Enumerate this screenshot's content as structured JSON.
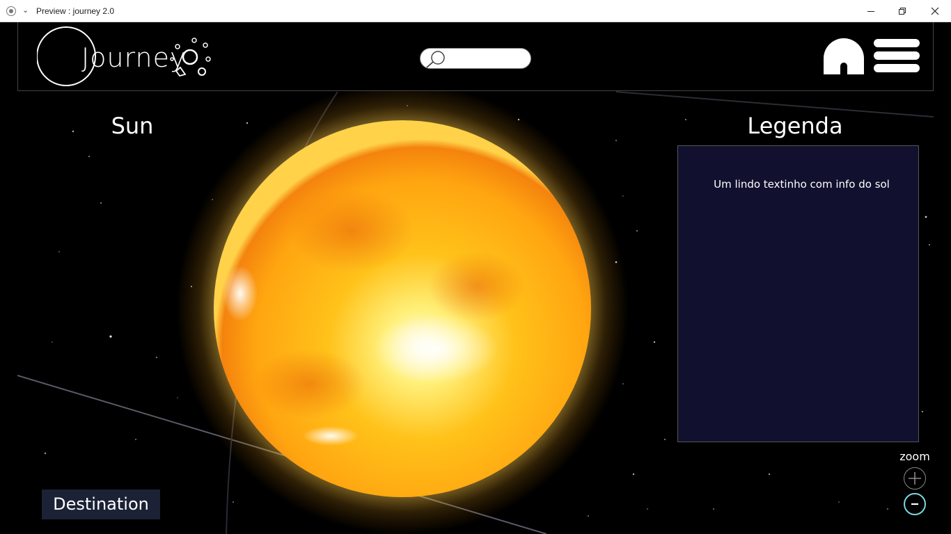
{
  "window": {
    "title": "Preview : journey 2.0"
  },
  "header": {
    "logo_text": "Journey",
    "search": {
      "placeholder": ""
    }
  },
  "planet": {
    "name": "Sun"
  },
  "legend": {
    "title": "Legenda",
    "text": "Um lindo textinho com info do sol"
  },
  "zoom": {
    "label": "zoom"
  },
  "destination": {
    "label": "Destination"
  },
  "colors": {
    "background": "#000000",
    "legend_panel": "#11112f",
    "destination_button": "#1c2235",
    "zoom_out_ring": "#7fd8e0",
    "sun_core": "#fff3a0",
    "sun_mid": "#ffb400",
    "sun_edge": "#f47a0c"
  },
  "icons": {
    "app": "app-icon",
    "chevron": "chevron-down-icon",
    "minimize": "minimize-icon",
    "restore": "restore-icon",
    "close": "close-icon",
    "logo": "journey-logo-icon",
    "search": "search-icon",
    "home": "home-icon",
    "menu": "hamburger-menu-icon",
    "zoom_in": "plus-icon",
    "zoom_out": "minus-icon"
  }
}
